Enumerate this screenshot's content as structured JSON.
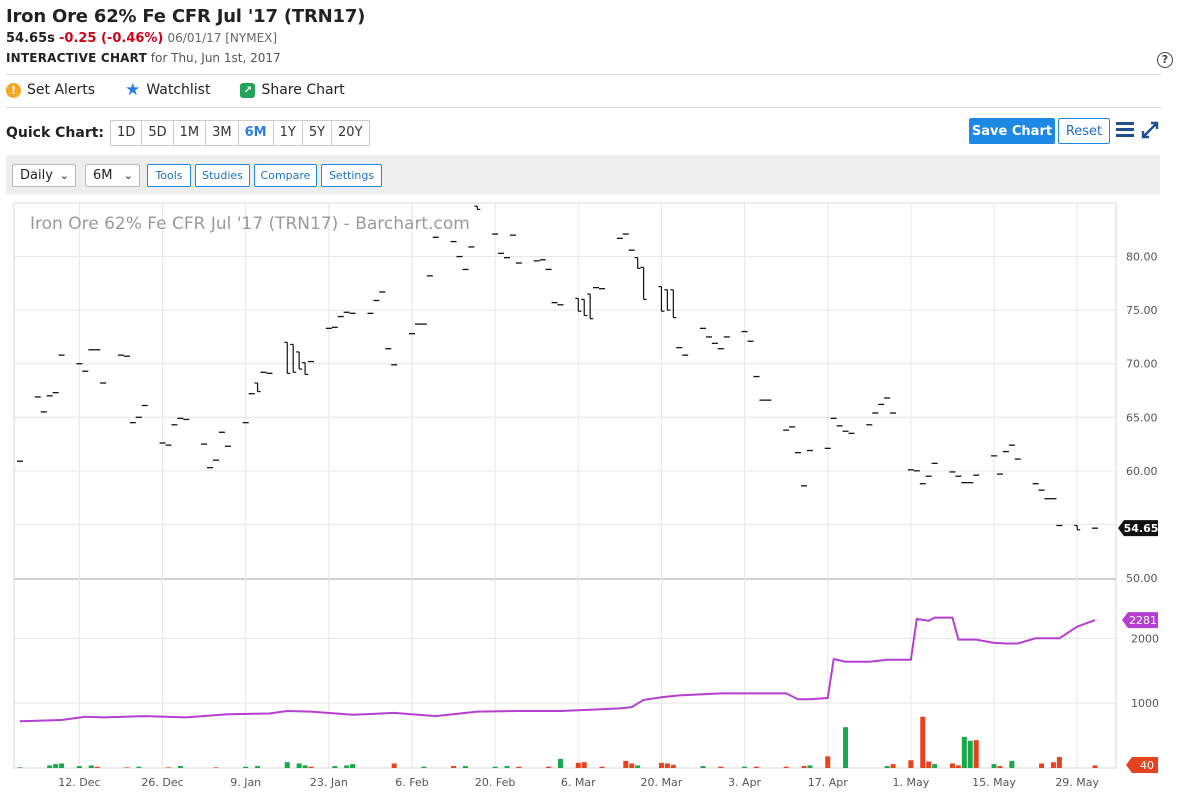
{
  "header": {
    "title": "Iron Ore 62% Fe CFR Jul '17 (TRN17)",
    "last": "54.65s",
    "change": "-0.25 (-0.46%)",
    "meta": "06/01/17 [NYMEX]",
    "interactive_label": "INTERACTIVE CHART",
    "interactive_for": "for Thu, Jun 1st, 2017"
  },
  "actions": {
    "alerts": "Set Alerts",
    "watchlist": "Watchlist",
    "share": "Share Chart"
  },
  "icons": {
    "alert": "alert-icon",
    "watchlist": "star-icon",
    "share": "share-icon",
    "help": "help-icon",
    "menu": "hamburger-icon",
    "expand": "expand-icon"
  },
  "quick_chart": {
    "label": "Quick Chart:",
    "periods": [
      "1D",
      "5D",
      "1M",
      "3M",
      "6M",
      "1Y",
      "5Y",
      "20Y"
    ],
    "active": "6M"
  },
  "buttons": {
    "save": "Save Chart",
    "reset": "Reset",
    "help": "?"
  },
  "toolbar": {
    "interval": "Daily",
    "range": "6M",
    "tools": "Tools",
    "studies": "Studies",
    "compare": "Compare",
    "settings": "Settings"
  },
  "colors": {
    "accent": "#1e88e5",
    "up": "#1aa84d",
    "down": "#e8431f",
    "open_interest": "#b53fd1",
    "negative": "#d0021b"
  },
  "chart_data": {
    "type": "bar",
    "watermark": "Iron Ore 62% Fe CFR Jul '17 (TRN17) - Barchart.com",
    "x_ticks": [
      "12. Dec",
      "26. Dec",
      "9. Jan",
      "23. Jan",
      "6. Feb",
      "20. Feb",
      "6. Mar",
      "20. Mar",
      "3. Apr",
      "17. Apr",
      "1. May",
      "15. May",
      "29. May"
    ],
    "x_range": [
      "2016-12-02",
      "2017-06-01"
    ],
    "price": {
      "ylim": [
        50,
        85
      ],
      "y_ticks": [
        "50.00",
        "55.00",
        "60.00",
        "65.00",
        "70.00",
        "75.00",
        "80.00"
      ],
      "last_label": "54.65",
      "bars": [
        [
          "2016-12-02",
          60.9,
          60.9
        ],
        [
          "2016-12-05",
          66.9,
          66.9
        ],
        [
          "2016-12-06",
          65.5,
          65.5
        ],
        [
          "2016-12-07",
          67.0,
          67.0
        ],
        [
          "2016-12-08",
          67.3,
          67.3
        ],
        [
          "2016-12-09",
          70.8,
          70.8
        ],
        [
          "2016-12-12",
          70.0,
          70.0
        ],
        [
          "2016-12-13",
          69.3,
          69.3
        ],
        [
          "2016-12-14",
          71.3,
          71.3
        ],
        [
          "2016-12-15",
          71.3,
          71.3
        ],
        [
          "2016-12-16",
          68.2,
          68.2
        ],
        [
          "2016-12-19",
          70.8,
          70.8
        ],
        [
          "2016-12-20",
          70.7,
          70.7
        ],
        [
          "2016-12-21",
          64.5,
          64.5
        ],
        [
          "2016-12-22",
          65.0,
          65.0
        ],
        [
          "2016-12-23",
          66.1,
          66.1
        ],
        [
          "2016-12-26",
          62.6,
          62.6
        ],
        [
          "2016-12-27",
          62.4,
          62.4
        ],
        [
          "2016-12-28",
          64.3,
          64.3
        ],
        [
          "2016-12-29",
          64.9,
          64.9
        ],
        [
          "2016-12-30",
          64.8,
          64.8
        ],
        [
          "2017-01-02",
          62.5,
          62.5
        ],
        [
          "2017-01-03",
          60.3,
          60.3
        ],
        [
          "2017-01-04",
          61.0,
          61.0
        ],
        [
          "2017-01-05",
          63.6,
          63.6
        ],
        [
          "2017-01-06",
          62.3,
          62.3
        ],
        [
          "2017-01-09",
          64.5,
          64.5
        ],
        [
          "2017-01-10",
          67.2,
          67.2
        ],
        [
          "2017-01-11",
          67.4,
          68.2
        ],
        [
          "2017-01-12",
          69.2,
          69.2
        ],
        [
          "2017-01-13",
          69.1,
          69.1
        ],
        [
          "2017-01-16",
          69.1,
          72.0
        ],
        [
          "2017-01-17",
          69.2,
          71.8
        ],
        [
          "2017-01-18",
          69.5,
          71.1
        ],
        [
          "2017-01-19",
          69.0,
          70.1
        ],
        [
          "2017-01-20",
          70.2,
          70.2
        ],
        [
          "2017-01-23",
          73.3,
          73.3
        ],
        [
          "2017-01-24",
          73.4,
          73.4
        ],
        [
          "2017-01-25",
          74.4,
          74.4
        ],
        [
          "2017-01-26",
          74.8,
          74.8
        ],
        [
          "2017-01-27",
          74.7,
          74.7
        ],
        [
          "2017-01-30",
          74.7,
          74.7
        ],
        [
          "2017-01-31",
          75.9,
          75.9
        ],
        [
          "2017-02-01",
          76.7,
          76.7
        ],
        [
          "2017-02-02",
          71.4,
          71.4
        ],
        [
          "2017-02-03",
          69.9,
          69.9
        ],
        [
          "2017-02-06",
          72.8,
          72.8
        ],
        [
          "2017-02-07",
          73.7,
          73.7
        ],
        [
          "2017-02-08",
          73.7,
          73.7
        ],
        [
          "2017-02-09",
          78.2,
          78.2
        ],
        [
          "2017-02-10",
          81.8,
          81.8
        ],
        [
          "2017-02-13",
          81.4,
          81.4
        ],
        [
          "2017-02-14",
          80.0,
          80.0
        ],
        [
          "2017-02-15",
          78.8,
          78.8
        ],
        [
          "2017-02-16",
          80.9,
          80.9
        ],
        [
          "2017-02-17",
          84.4,
          84.7
        ],
        [
          "2017-02-20",
          82.1,
          82.1
        ],
        [
          "2017-02-21",
          80.3,
          80.3
        ],
        [
          "2017-02-22",
          79.9,
          79.9
        ],
        [
          "2017-02-23",
          82.0,
          82.0
        ],
        [
          "2017-02-24",
          79.4,
          79.4
        ],
        [
          "2017-02-27",
          79.6,
          79.6
        ],
        [
          "2017-02-28",
          79.7,
          79.7
        ],
        [
          "2017-03-01",
          78.8,
          78.8
        ],
        [
          "2017-03-02",
          75.7,
          75.7
        ],
        [
          "2017-03-03",
          75.5,
          75.5
        ],
        [
          "2017-03-06",
          74.9,
          76.1
        ],
        [
          "2017-03-07",
          74.5,
          76.0
        ],
        [
          "2017-03-08",
          74.2,
          76.5
        ],
        [
          "2017-03-09",
          77.1,
          77.1
        ],
        [
          "2017-03-10",
          77.0,
          77.0
        ],
        [
          "2017-03-13",
          81.7,
          81.7
        ],
        [
          "2017-03-14",
          82.1,
          82.1
        ],
        [
          "2017-03-15",
          80.6,
          80.6
        ],
        [
          "2017-03-16",
          78.9,
          79.9
        ],
        [
          "2017-03-17",
          76.0,
          79.0
        ],
        [
          "2017-03-20",
          74.9,
          77.2
        ],
        [
          "2017-03-21",
          75.0,
          76.9
        ],
        [
          "2017-03-22",
          74.3,
          76.9
        ],
        [
          "2017-03-23",
          71.5,
          71.5
        ],
        [
          "2017-03-24",
          70.8,
          70.8
        ],
        [
          "2017-03-27",
          73.3,
          73.3
        ],
        [
          "2017-03-28",
          72.5,
          72.5
        ],
        [
          "2017-03-29",
          71.9,
          71.9
        ],
        [
          "2017-03-30",
          71.4,
          71.4
        ],
        [
          "2017-03-31",
          72.5,
          72.5
        ],
        [
          "2017-04-03",
          73.0,
          73.0
        ],
        [
          "2017-04-04",
          72.1,
          72.1
        ],
        [
          "2017-04-05",
          68.8,
          68.8
        ],
        [
          "2017-04-06",
          66.6,
          66.6
        ],
        [
          "2017-04-07",
          66.6,
          66.6
        ],
        [
          "2017-04-10",
          63.8,
          63.8
        ],
        [
          "2017-04-11",
          64.1,
          64.1
        ],
        [
          "2017-04-12",
          61.7,
          61.7
        ],
        [
          "2017-04-13",
          58.6,
          58.6
        ],
        [
          "2017-04-14",
          61.9,
          61.9
        ],
        [
          "2017-04-17",
          62.1,
          62.1
        ],
        [
          "2017-04-18",
          64.9,
          64.9
        ],
        [
          "2017-04-19",
          64.2,
          64.2
        ],
        [
          "2017-04-20",
          63.7,
          63.7
        ],
        [
          "2017-04-21",
          63.5,
          63.5
        ],
        [
          "2017-04-24",
          64.3,
          64.3
        ],
        [
          "2017-04-25",
          65.4,
          65.4
        ],
        [
          "2017-04-26",
          66.2,
          66.2
        ],
        [
          "2017-04-27",
          66.8,
          66.8
        ],
        [
          "2017-04-28",
          65.4,
          65.4
        ],
        [
          "2017-05-01",
          60.1,
          60.1
        ],
        [
          "2017-05-02",
          60.0,
          60.0
        ],
        [
          "2017-05-03",
          58.8,
          58.8
        ],
        [
          "2017-05-04",
          59.5,
          59.5
        ],
        [
          "2017-05-05",
          60.7,
          60.7
        ],
        [
          "2017-05-08",
          59.9,
          59.9
        ],
        [
          "2017-05-09",
          59.5,
          59.5
        ],
        [
          "2017-05-10",
          58.9,
          58.9
        ],
        [
          "2017-05-11",
          58.9,
          58.9
        ],
        [
          "2017-05-12",
          59.6,
          59.6
        ],
        [
          "2017-05-15",
          61.4,
          61.4
        ],
        [
          "2017-05-16",
          59.7,
          59.7
        ],
        [
          "2017-05-17",
          61.8,
          61.8
        ],
        [
          "2017-05-18",
          62.4,
          62.4
        ],
        [
          "2017-05-19",
          61.1,
          61.1
        ],
        [
          "2017-05-22",
          58.8,
          58.8
        ],
        [
          "2017-05-23",
          58.2,
          58.2
        ],
        [
          "2017-05-24",
          57.4,
          57.4
        ],
        [
          "2017-05-25",
          57.4,
          57.4
        ],
        [
          "2017-05-26",
          54.9,
          54.9
        ],
        [
          "2017-05-29",
          54.5,
          54.9
        ],
        [
          "2017-06-01",
          54.65,
          54.65
        ]
      ]
    },
    "volume": {
      "ylim": [
        0,
        2900
      ],
      "y_ticks": [
        "1000",
        "2000"
      ],
      "open_interest_label": "2281",
      "volume_label": "40",
      "open_interest": [
        [
          "2016-12-02",
          720
        ],
        [
          "2016-12-09",
          740
        ],
        [
          "2016-12-13",
          790
        ],
        [
          "2016-12-16",
          780
        ],
        [
          "2016-12-23",
          800
        ],
        [
          "2016-12-30",
          780
        ],
        [
          "2017-01-06",
          830
        ],
        [
          "2017-01-13",
          840
        ],
        [
          "2017-01-16",
          880
        ],
        [
          "2017-01-20",
          870
        ],
        [
          "2017-01-27",
          820
        ],
        [
          "2017-02-03",
          850
        ],
        [
          "2017-02-10",
          800
        ],
        [
          "2017-02-17",
          870
        ],
        [
          "2017-02-24",
          880
        ],
        [
          "2017-03-03",
          880
        ],
        [
          "2017-03-08",
          900
        ],
        [
          "2017-03-13",
          920
        ],
        [
          "2017-03-15",
          940
        ],
        [
          "2017-03-17",
          1050
        ],
        [
          "2017-03-20",
          1090
        ],
        [
          "2017-03-23",
          1120
        ],
        [
          "2017-03-30",
          1150
        ],
        [
          "2017-04-06",
          1150
        ],
        [
          "2017-04-10",
          1150
        ],
        [
          "2017-04-12",
          1060
        ],
        [
          "2017-04-14",
          1060
        ],
        [
          "2017-04-17",
          1080
        ],
        [
          "2017-04-18",
          1680
        ],
        [
          "2017-04-20",
          1640
        ],
        [
          "2017-04-24",
          1640
        ],
        [
          "2017-04-27",
          1670
        ],
        [
          "2017-05-01",
          1670
        ],
        [
          "2017-05-02",
          2300
        ],
        [
          "2017-05-04",
          2270
        ],
        [
          "2017-05-05",
          2320
        ],
        [
          "2017-05-08",
          2320
        ],
        [
          "2017-05-09",
          1980
        ],
        [
          "2017-05-12",
          1980
        ],
        [
          "2017-05-15",
          1930
        ],
        [
          "2017-05-17",
          1920
        ],
        [
          "2017-05-19",
          1920
        ],
        [
          "2017-05-22",
          2000
        ],
        [
          "2017-05-26",
          2000
        ],
        [
          "2017-05-29",
          2180
        ],
        [
          "2017-06-01",
          2281
        ]
      ],
      "volume": [
        [
          "2016-12-02",
          10,
          "up"
        ],
        [
          "2016-12-07",
          40,
          "up"
        ],
        [
          "2016-12-08",
          60,
          "up"
        ],
        [
          "2016-12-09",
          70,
          "up"
        ],
        [
          "2016-12-12",
          30,
          "up"
        ],
        [
          "2016-12-14",
          40,
          "up"
        ],
        [
          "2016-12-15",
          20,
          "down"
        ],
        [
          "2016-12-20",
          10,
          "down"
        ],
        [
          "2016-12-22",
          20,
          "up"
        ],
        [
          "2016-12-27",
          10,
          "down"
        ],
        [
          "2016-12-29",
          30,
          "up"
        ],
        [
          "2017-01-04",
          10,
          "down"
        ],
        [
          "2017-01-09",
          20,
          "up"
        ],
        [
          "2017-01-11",
          30,
          "up"
        ],
        [
          "2017-01-16",
          90,
          "up"
        ],
        [
          "2017-01-18",
          70,
          "up"
        ],
        [
          "2017-01-19",
          40,
          "up"
        ],
        [
          "2017-01-20",
          20,
          "down"
        ],
        [
          "2017-01-24",
          30,
          "up"
        ],
        [
          "2017-01-26",
          40,
          "up"
        ],
        [
          "2017-01-27",
          60,
          "up"
        ],
        [
          "2017-02-03",
          70,
          "down"
        ],
        [
          "2017-02-08",
          20,
          "up"
        ],
        [
          "2017-02-13",
          30,
          "down"
        ],
        [
          "2017-02-15",
          30,
          "up"
        ],
        [
          "2017-02-20",
          20,
          "up"
        ],
        [
          "2017-02-22",
          30,
          "up"
        ],
        [
          "2017-02-24",
          20,
          "down"
        ],
        [
          "2017-03-01",
          20,
          "down"
        ],
        [
          "2017-03-03",
          140,
          "up"
        ],
        [
          "2017-03-06",
          80,
          "down"
        ],
        [
          "2017-03-07",
          90,
          "down"
        ],
        [
          "2017-03-10",
          20,
          "down"
        ],
        [
          "2017-03-14",
          110,
          "down"
        ],
        [
          "2017-03-15",
          70,
          "down"
        ],
        [
          "2017-03-16",
          40,
          "up"
        ],
        [
          "2017-03-20",
          80,
          "down"
        ],
        [
          "2017-03-21",
          70,
          "down"
        ],
        [
          "2017-03-22",
          50,
          "down"
        ],
        [
          "2017-03-27",
          30,
          "up"
        ],
        [
          "2017-03-30",
          20,
          "down"
        ],
        [
          "2017-04-03",
          20,
          "up"
        ],
        [
          "2017-04-05",
          20,
          "down"
        ],
        [
          "2017-04-10",
          20,
          "down"
        ],
        [
          "2017-04-13",
          30,
          "down"
        ],
        [
          "2017-04-14",
          40,
          "up"
        ],
        [
          "2017-04-17",
          180,
          "down"
        ],
        [
          "2017-04-20",
          630,
          "up"
        ],
        [
          "2017-04-27",
          30,
          "up"
        ],
        [
          "2017-04-28",
          60,
          "down"
        ],
        [
          "2017-05-01",
          120,
          "down"
        ],
        [
          "2017-05-03",
          790,
          "down"
        ],
        [
          "2017-05-04",
          100,
          "down"
        ],
        [
          "2017-05-05",
          60,
          "up"
        ],
        [
          "2017-05-08",
          70,
          "down"
        ],
        [
          "2017-05-09",
          40,
          "down"
        ],
        [
          "2017-05-10",
          480,
          "up"
        ],
        [
          "2017-05-11",
          420,
          "up"
        ],
        [
          "2017-05-12",
          430,
          "down"
        ],
        [
          "2017-05-15",
          60,
          "up"
        ],
        [
          "2017-05-16",
          30,
          "down"
        ],
        [
          "2017-05-18",
          110,
          "up"
        ],
        [
          "2017-05-23",
          70,
          "down"
        ],
        [
          "2017-05-25",
          90,
          "down"
        ],
        [
          "2017-05-26",
          170,
          "down"
        ],
        [
          "2017-06-01",
          40,
          "down"
        ]
      ]
    }
  }
}
